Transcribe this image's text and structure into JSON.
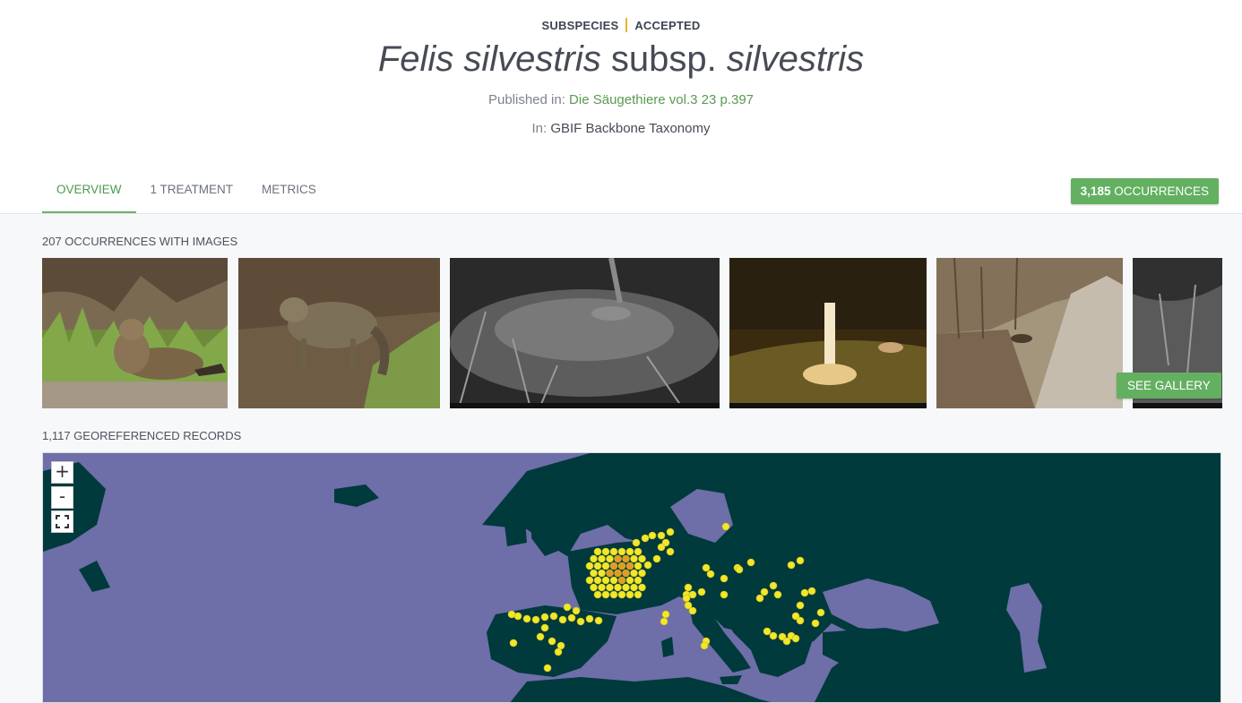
{
  "header": {
    "rank": "SUBSPECIES",
    "status": "ACCEPTED",
    "title_genus_species": "Felis silvestris",
    "title_rank_marker": "subsp.",
    "title_infraspecific": "silvestris",
    "published_prefix": "Published in:",
    "published_ref": "Die Säugethiere vol.3 23 p.397",
    "in_prefix": "In:",
    "in_value": "GBIF Backbone Taxonomy"
  },
  "tabs": [
    {
      "label": "OVERVIEW",
      "active": true
    },
    {
      "label": "1 TREATMENT",
      "active": false
    },
    {
      "label": "METRICS",
      "active": false
    }
  ],
  "occurrences_button": {
    "count": "3,185",
    "label": "OCCURRENCES"
  },
  "images_section": {
    "label": "207 OCCURRENCES WITH IMAGES",
    "see_gallery": "SEE GALLERY"
  },
  "map_section": {
    "label": "1,117 GEOREFERENCED RECORDS",
    "zoom_in": "+",
    "zoom_out": "-",
    "fullscreen_icon": "fullscreen-icon"
  },
  "colors": {
    "accent_green": "#64b061",
    "status_divider": "#e5b530",
    "sea": "#6e6ea8",
    "land": "#003a3c",
    "dot_low": "#f0e82a",
    "dot_high": "#e49a2a"
  }
}
